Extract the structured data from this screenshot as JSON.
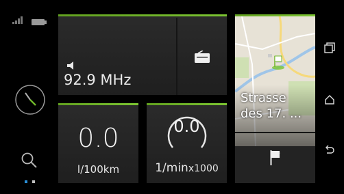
{
  "status": {
    "signal_icon": "signal-icon",
    "battery_icon": "battery-icon"
  },
  "sidebar": {
    "compass_icon": "compass-icon",
    "search_icon": "search-icon",
    "page_indicator_count": 2,
    "active_page": 1
  },
  "radio": {
    "volume_icon": "volume-icon",
    "frequency": "92.9 MHz",
    "source_icon": "radio-icon"
  },
  "consumption": {
    "value": "0.0",
    "unit": "l/100km"
  },
  "rpm": {
    "value": "0.0",
    "unit_main": "1/min",
    "unit_mult": "x1000"
  },
  "navigation": {
    "street_line1": "Strasse",
    "street_line2": "des 17. ...",
    "flag_icon": "flag-icon"
  },
  "system_nav": {
    "recents_icon": "recents-icon",
    "home_icon": "home-icon",
    "back_icon": "back-icon"
  },
  "colors": {
    "accent_green": "#6fb52a",
    "tile_bg": "#262626",
    "background": "#000000"
  }
}
